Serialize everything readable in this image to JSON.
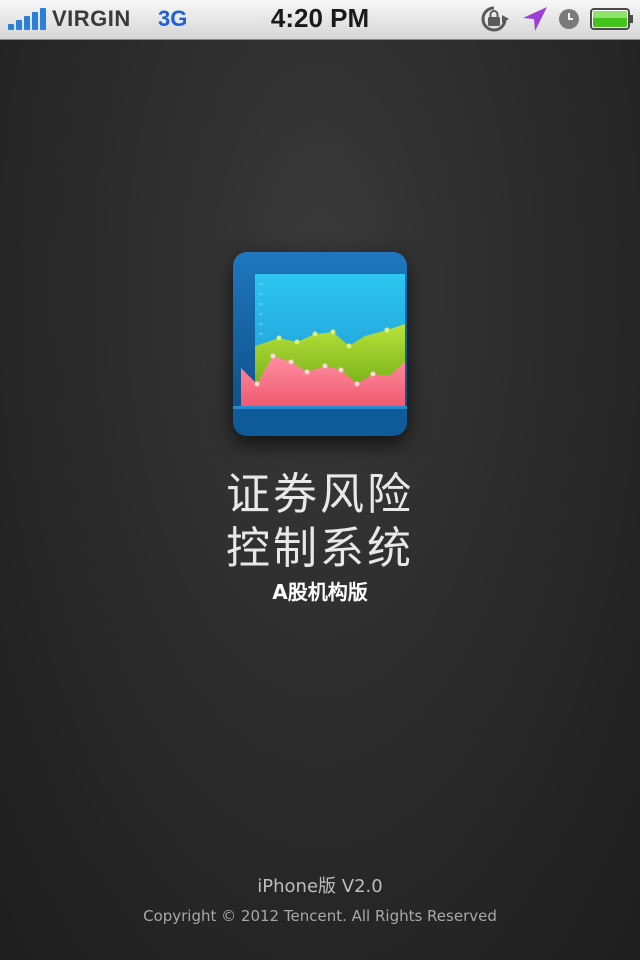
{
  "status_bar": {
    "carrier": "VIRGIN",
    "network": "3G",
    "time": "4:20 PM",
    "icons": [
      "signal-bars-icon",
      "rotation-lock-icon",
      "location-arrow-icon",
      "alarm-clock-icon",
      "battery-icon"
    ],
    "battery_level": 1.0,
    "colors": {
      "network": "#1f5fd6",
      "location": "#9b3fd6",
      "battery": "#43c31c"
    }
  },
  "app": {
    "icon": "stock-chart-app-icon",
    "title_line1": "证券风险",
    "title_line2": "控制系统",
    "subtitle": "A股机构版"
  },
  "footer": {
    "version": "iPhone版 V2.0",
    "copyright": "Copyright © 2012 Tencent. All Rights Reserved"
  }
}
